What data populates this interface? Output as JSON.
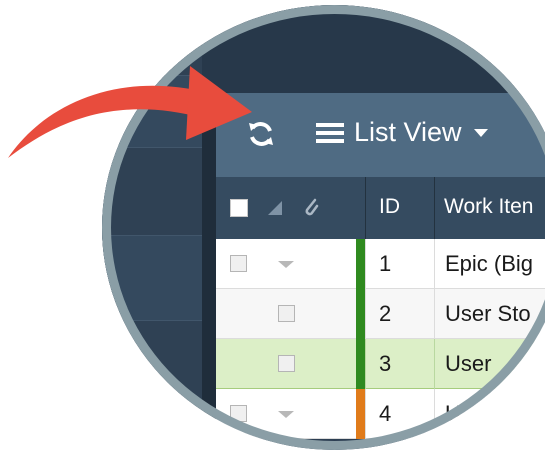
{
  "toolbar": {
    "refresh_icon": "refresh-icon",
    "view_icon": "list-icon",
    "view_label": "List View",
    "dropdown_icon": "caret-down-icon"
  },
  "table": {
    "header": {
      "id_label": "ID",
      "work_item_label": "Work Iten"
    },
    "rows": [
      {
        "id": "1",
        "work": "Epic (Big",
        "color": "#2f8a1f"
      },
      {
        "id": "2",
        "work": "User Sto",
        "color": "#2f8a1f"
      },
      {
        "id": "3",
        "work": "User",
        "color": "#2f8a1f"
      },
      {
        "id": "4",
        "work": "U",
        "color": "#e07b1a"
      }
    ]
  },
  "colors": {
    "arrow": "#e84c3d",
    "toolbar_bg": "#4f6b83",
    "highlight_row": "#dcefc7",
    "lens_border": "#8a9ea6"
  }
}
